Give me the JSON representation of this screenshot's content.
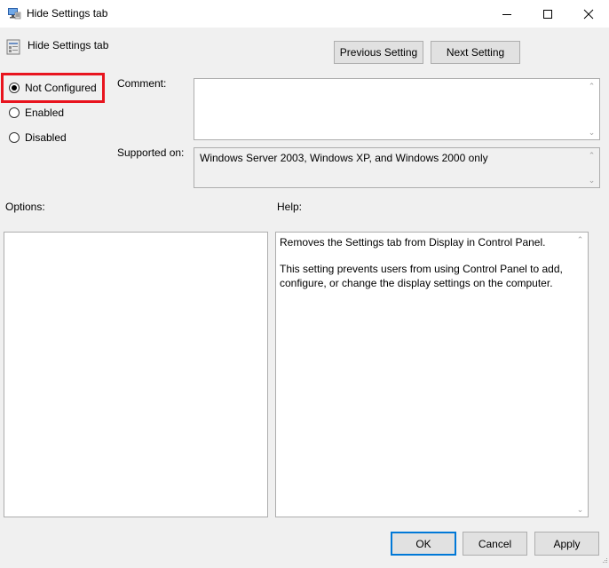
{
  "window": {
    "title": "Hide Settings tab",
    "minimize_icon": "minimize-icon",
    "maximize_icon": "maximize-icon",
    "close_icon": "close-icon"
  },
  "header": {
    "setting_name": "Hide Settings tab",
    "previous_label": "Previous Setting",
    "next_label": "Next Setting"
  },
  "state": {
    "options": [
      {
        "label": "Not Configured",
        "selected": true
      },
      {
        "label": "Enabled",
        "selected": false
      },
      {
        "label": "Disabled",
        "selected": false
      }
    ]
  },
  "comment": {
    "label": "Comment:",
    "value": ""
  },
  "supported": {
    "label": "Supported on:",
    "value": "Windows Server 2003, Windows XP, and Windows 2000 only"
  },
  "options_panel": {
    "label": "Options:"
  },
  "help_panel": {
    "label": "Help:",
    "paragraph1": "Removes the Settings tab from Display in Control Panel.",
    "paragraph2": "This setting prevents users from using Control Panel to add, configure, or change the display settings on the computer."
  },
  "footer": {
    "ok_label": "OK",
    "cancel_label": "Cancel",
    "apply_label": "Apply"
  },
  "colors": {
    "highlight": "#e8141e",
    "accent": "#0078d7"
  }
}
